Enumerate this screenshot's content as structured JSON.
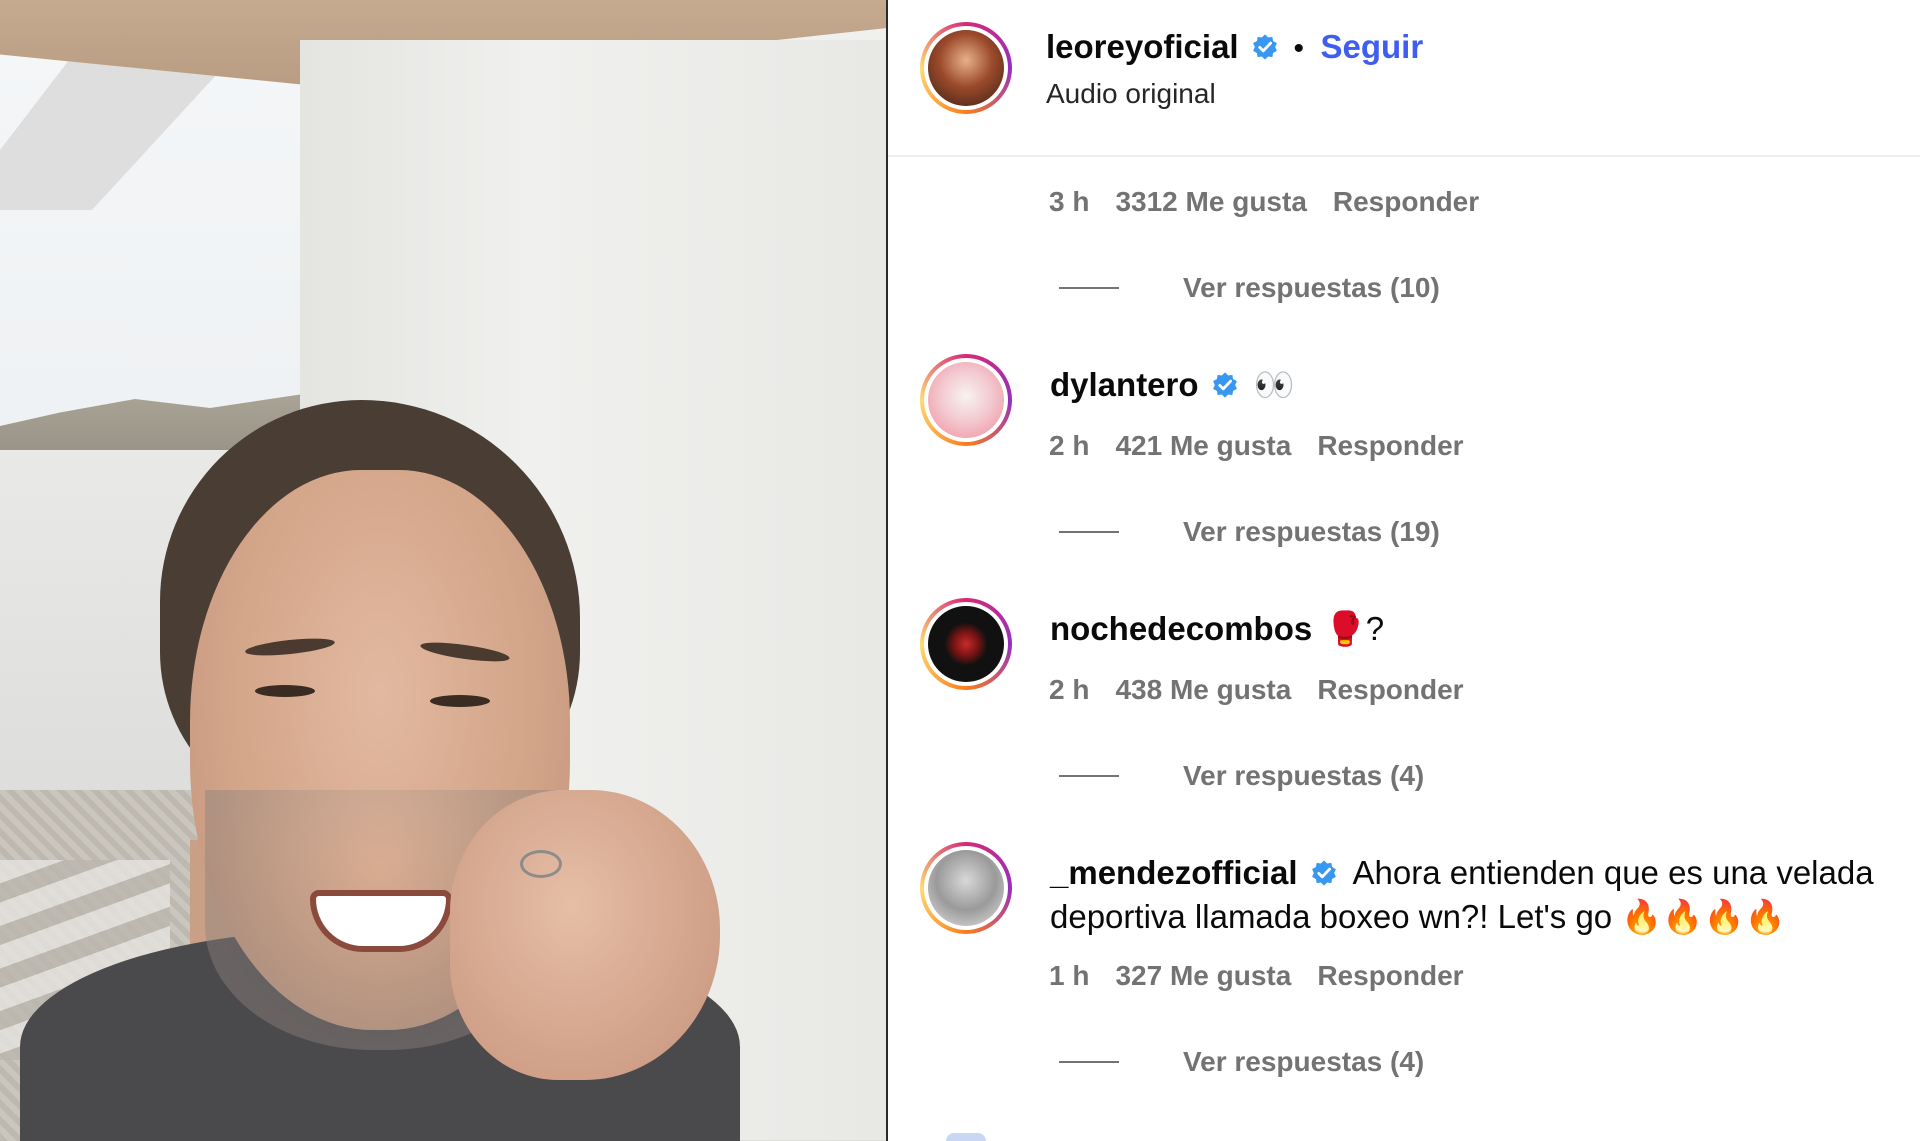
{
  "header": {
    "username": "leoreyoficial",
    "separator": "•",
    "follow_label": "Seguir",
    "audio_label": "Audio original"
  },
  "first_comment_meta": {
    "time": "3 h",
    "likes": "3312 Me gusta",
    "reply": "Responder",
    "view_replies": "Ver respuestas (10)"
  },
  "comments": [
    {
      "username": "dylantero",
      "text": "👀",
      "time": "2 h",
      "likes": "421 Me gusta",
      "reply": "Responder",
      "view_replies": "Ver respuestas (19)"
    },
    {
      "username": "nochedecombos",
      "text": "🥊?",
      "time": "2 h",
      "likes": "438 Me gusta",
      "reply": "Responder",
      "view_replies": "Ver respuestas (4)"
    },
    {
      "username": "_mendezofficial",
      "text_line1": "Ahora entienden que es una velada",
      "text_line2": "deportiva llamada boxeo wn?! Let's go 🔥🔥🔥🔥",
      "time": "1 h",
      "likes": "327 Me gusta",
      "reply": "Responder",
      "view_replies": "Ver respuestas (4)"
    }
  ],
  "colors": {
    "follow_blue": "#3d5ef0",
    "verified_blue": "#3897f0",
    "meta_gray": "#737373"
  },
  "icons": {
    "verified": "verified-badge-icon"
  }
}
